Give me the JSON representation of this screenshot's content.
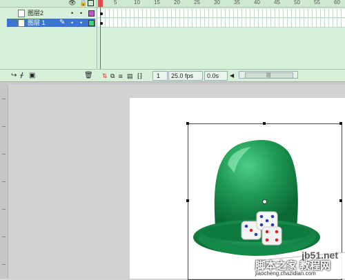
{
  "layers": {
    "header_icons": [
      "eye-icon",
      "lock-icon",
      "outline-icon"
    ],
    "rows": [
      {
        "name": "图层2",
        "selected": false,
        "color": "#c94be0"
      },
      {
        "name": "图层 1",
        "selected": true,
        "color": "#3ad86a"
      }
    ],
    "tools": {
      "add_layer_icon": "add-layer-icon",
      "trash_icon": "trash-icon"
    }
  },
  "ruler": {
    "ticks": [
      "5",
      "10",
      "15",
      "20",
      "25",
      "30",
      "35",
      "40",
      "45",
      "50",
      "55",
      "60"
    ]
  },
  "timeline_status": {
    "current_frame": "1",
    "fps": "25.0 fps",
    "elapsed": "0.0s"
  },
  "watermark": {
    "line1": "jb51.net",
    "line2": "脚本之家 教程网",
    "line3": "jiaocheng.chazidian.com"
  },
  "colors": {
    "timeline_bg": "#d7f0d8",
    "selection": "#3c74d4",
    "playhead": "#e23a3a",
    "cup_green": "#1f9a54"
  }
}
